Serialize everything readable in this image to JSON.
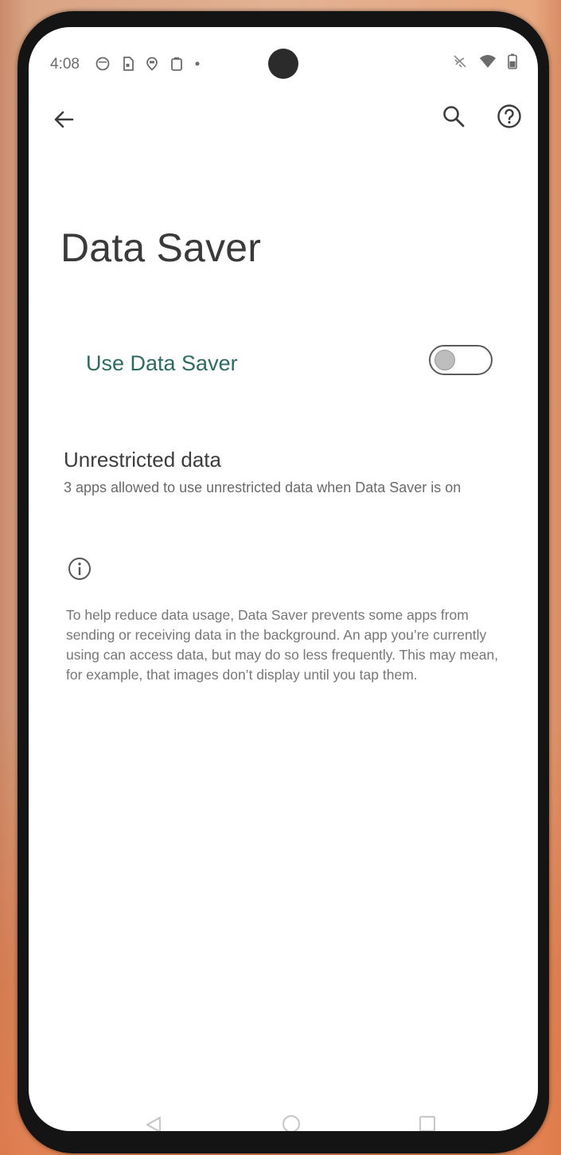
{
  "status_bar": {
    "time": "4:08",
    "left_icons": [
      "messenger-icon",
      "sim-card-icon",
      "location-icon",
      "clipboard-icon",
      "dot-icon"
    ],
    "right_icons": [
      "dnd-off-icon",
      "wifi-icon",
      "battery-icon"
    ]
  },
  "app_bar": {
    "back_icon": "arrow-back-icon",
    "search_icon": "search-icon",
    "help_icon": "help-icon"
  },
  "page": {
    "title": "Data Saver",
    "toggle_label": "Use Data Saver",
    "toggle_on": false,
    "unrestricted_title": "Unrestricted data",
    "unrestricted_summary": "3 apps allowed to use unrestricted data when Data Saver is on",
    "info_text": "To help reduce data usage, Data Saver prevents some apps from sending or receiving data in the background. An app you’re currently using can access data, but may do so less frequently. This may mean, for example, that images don’t display until you tap them."
  },
  "nav_bar": {
    "back_icon": "nav-back-icon",
    "home_icon": "nav-home-icon",
    "recents_icon": "nav-recents-icon"
  },
  "colors": {
    "accent": "#2f6a62",
    "title": "#3a3a3a",
    "secondary_text": "#6a6a6a"
  }
}
